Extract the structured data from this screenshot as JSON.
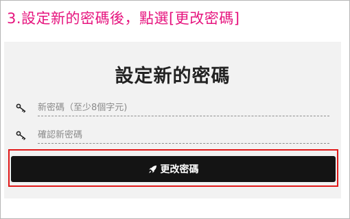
{
  "step_title": "3.設定新的密碼後，點選[更改密碼]",
  "form": {
    "title": "設定新的密碼",
    "new_password": {
      "placeholder": "新密碼（至少8個字元)",
      "icon": "key-icon"
    },
    "confirm_password": {
      "placeholder": "確認新密碼",
      "icon": "key-icon"
    },
    "submit_label": "更改密碼",
    "submit_icon": "rocket-icon"
  },
  "colors": {
    "step_title": "#e6147e",
    "button_bg": "#141414",
    "highlight_border": "#e01818",
    "panel_bg": "#f2f2f2"
  }
}
